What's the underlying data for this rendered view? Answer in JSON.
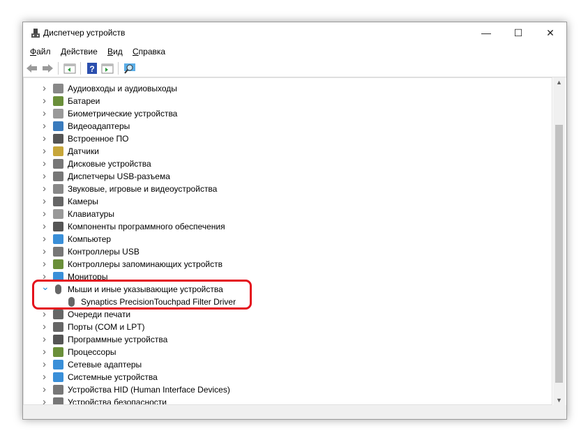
{
  "window": {
    "title": "Диспетчер устройств",
    "minimize": "—",
    "maximize": "☐",
    "close": "✕"
  },
  "menu": [
    "Файл",
    "Действие",
    "Вид",
    "Справка"
  ],
  "toolbar": [
    "back-icon",
    "forward-icon",
    "show-hide-tree-icon",
    "help-icon",
    "properties-icon",
    "scan-hardware-icon"
  ],
  "tree": [
    {
      "label": "Аудиовходы и аудиовыходы",
      "icon": "speaker-icon",
      "color": "#888888"
    },
    {
      "label": "Батареи",
      "icon": "battery-icon",
      "color": "#6a8f3a"
    },
    {
      "label": "Биометрические устройства",
      "icon": "fingerprint-icon",
      "color": "#999999"
    },
    {
      "label": "Видеоадаптеры",
      "icon": "display-adapter-icon",
      "color": "#3a7bbd"
    },
    {
      "label": "Встроенное ПО",
      "icon": "firmware-icon",
      "color": "#555555"
    },
    {
      "label": "Датчики",
      "icon": "sensor-icon",
      "color": "#c7a63a"
    },
    {
      "label": "Дисковые устройства",
      "icon": "disk-icon",
      "color": "#777777"
    },
    {
      "label": "Диспетчеры USB-разъема",
      "icon": "usb-icon",
      "color": "#777777"
    },
    {
      "label": "Звуковые, игровые и видеоустройства",
      "icon": "sound-icon",
      "color": "#888888"
    },
    {
      "label": "Камеры",
      "icon": "camera-icon",
      "color": "#666666"
    },
    {
      "label": "Клавиатуры",
      "icon": "keyboard-icon",
      "color": "#999999"
    },
    {
      "label": "Компоненты программного обеспечения",
      "icon": "software-component-icon",
      "color": "#555555"
    },
    {
      "label": "Компьютер",
      "icon": "computer-icon",
      "color": "#3a8fd8"
    },
    {
      "label": "Контроллеры USB",
      "icon": "usb-controller-icon",
      "color": "#777777"
    },
    {
      "label": "Контроллеры запоминающих устройств",
      "icon": "storage-controller-icon",
      "color": "#6a8f3a"
    },
    {
      "label": "Мониторы",
      "icon": "monitor-icon",
      "color": "#3a8fd8"
    },
    {
      "label": "Мыши и иные указывающие устройства",
      "icon": "mouse-icon",
      "color": "#666666",
      "expanded": true,
      "children": [
        {
          "label": "Synaptics PrecisionTouchpad Filter Driver",
          "icon": "mouse-icon"
        }
      ]
    },
    {
      "label": "Очереди печати",
      "icon": "printer-icon",
      "color": "#666666"
    },
    {
      "label": "Порты (COM и LPT)",
      "icon": "port-icon",
      "color": "#666666"
    },
    {
      "label": "Программные устройства",
      "icon": "software-device-icon",
      "color": "#555555"
    },
    {
      "label": "Процессоры",
      "icon": "processor-icon",
      "color": "#6a8f3a"
    },
    {
      "label": "Сетевые адаптеры",
      "icon": "network-adapter-icon",
      "color": "#3a8fd8"
    },
    {
      "label": "Системные устройства",
      "icon": "system-device-icon",
      "color": "#3a8fd8"
    },
    {
      "label": "Устройства HID (Human Interface Devices)",
      "icon": "hid-icon",
      "color": "#777777"
    },
    {
      "label": "Устройства безопасности",
      "icon": "security-device-icon",
      "color": "#777777"
    }
  ],
  "highlight_color": "#e4101c"
}
